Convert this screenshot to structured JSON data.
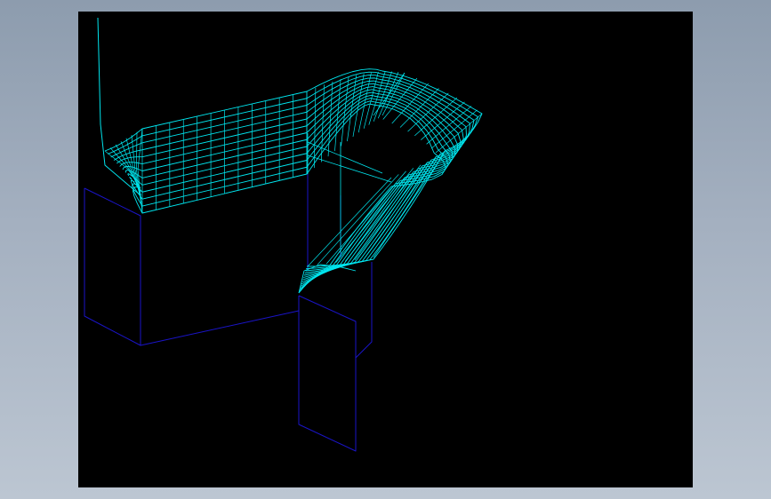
{
  "viewport": {
    "background": "#000000"
  },
  "colors": {
    "app_background_top": "#8d9cae",
    "app_background_bottom": "#bcc6d2",
    "surface_wire": "#00e5ee",
    "body_edge": "#1a14c8"
  },
  "model": {
    "render_mode": "wireframe",
    "parts": [
      {
        "name": "swept-channel-surface",
        "color_key": "surface_wire"
      },
      {
        "name": "lower-block-left",
        "color_key": "body_edge"
      },
      {
        "name": "lower-block-right",
        "color_key": "body_edge"
      }
    ]
  }
}
